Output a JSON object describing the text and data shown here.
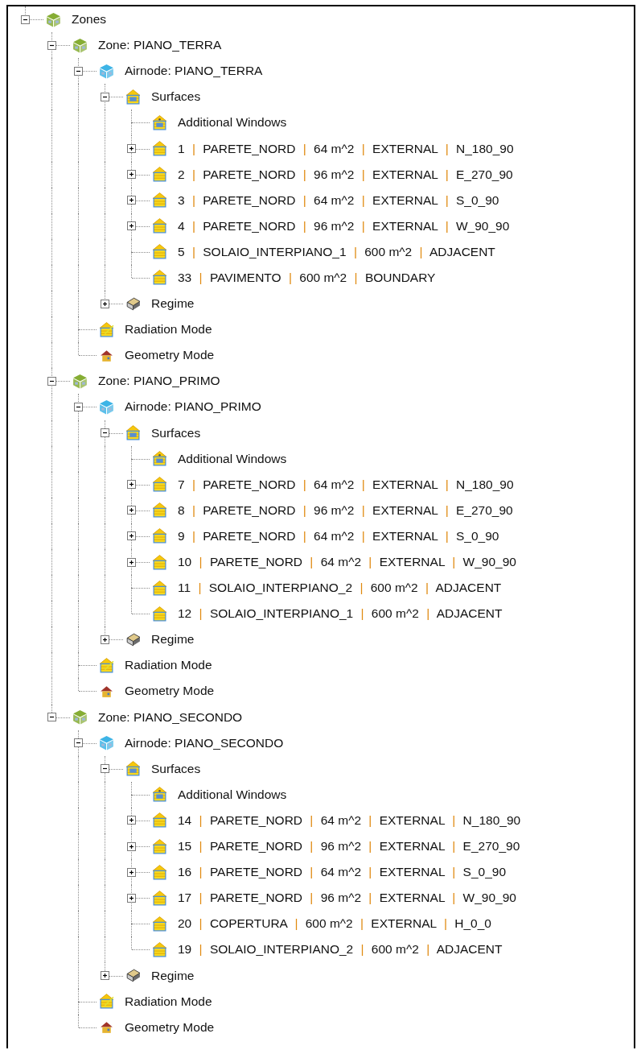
{
  "tree": [
    {
      "kind": "zones",
      "label": "Zones",
      "expanded": true,
      "children": [
        {
          "kind": "zone",
          "label": "Zone: PIANO_TERRA",
          "expanded": true,
          "children": [
            {
              "kind": "airnode",
              "label": "Airnode: PIANO_TERRA",
              "expanded": true,
              "children": [
                {
                  "kind": "surfaces",
                  "label": "Surfaces",
                  "expanded": true,
                  "children": [
                    {
                      "kind": "windows",
                      "label": "Additional Windows"
                    },
                    {
                      "kind": "surface",
                      "label": "1 | PARETE_NORD | 64 m^2 | EXTERNAL | N_180_90",
                      "expanded": false
                    },
                    {
                      "kind": "surface",
                      "label": "2 | PARETE_NORD | 96 m^2 | EXTERNAL | E_270_90",
                      "expanded": false
                    },
                    {
                      "kind": "surface",
                      "label": "3 | PARETE_NORD | 64 m^2 | EXTERNAL | S_0_90",
                      "expanded": false
                    },
                    {
                      "kind": "surface",
                      "label": "4 | PARETE_NORD | 96 m^2 | EXTERNAL | W_90_90",
                      "expanded": false
                    },
                    {
                      "kind": "surface",
                      "label": "5 | SOLAIO_INTERPIANO_1 | 600 m^2 | ADJACENT"
                    },
                    {
                      "kind": "surface",
                      "label": "33 | PAVIMENTO | 600 m^2 | BOUNDARY"
                    }
                  ]
                },
                {
                  "kind": "regime",
                  "label": "Regime",
                  "expanded": false
                }
              ]
            },
            {
              "kind": "radiation",
              "label": "Radiation Mode"
            },
            {
              "kind": "geometry",
              "label": "Geometry Mode"
            }
          ]
        },
        {
          "kind": "zone",
          "label": "Zone: PIANO_PRIMO",
          "expanded": true,
          "children": [
            {
              "kind": "airnode",
              "label": "Airnode: PIANO_PRIMO",
              "expanded": true,
              "children": [
                {
                  "kind": "surfaces",
                  "label": "Surfaces",
                  "expanded": true,
                  "children": [
                    {
                      "kind": "windows",
                      "label": "Additional Windows"
                    },
                    {
                      "kind": "surface",
                      "label": "7 | PARETE_NORD | 64 m^2 | EXTERNAL | N_180_90",
                      "expanded": false
                    },
                    {
                      "kind": "surface",
                      "label": "8 | PARETE_NORD | 96 m^2 | EXTERNAL | E_270_90",
                      "expanded": false
                    },
                    {
                      "kind": "surface",
                      "label": "9 | PARETE_NORD | 64 m^2 | EXTERNAL | S_0_90",
                      "expanded": false
                    },
                    {
                      "kind": "surface",
                      "label": "10 | PARETE_NORD | 64 m^2 | EXTERNAL | W_90_90",
                      "expanded": false
                    },
                    {
                      "kind": "surface",
                      "label": "11 | SOLAIO_INTERPIANO_2 | 600 m^2 | ADJACENT"
                    },
                    {
                      "kind": "surface",
                      "label": "12 | SOLAIO_INTERPIANO_1 | 600 m^2 | ADJACENT"
                    }
                  ]
                },
                {
                  "kind": "regime",
                  "label": "Regime",
                  "expanded": false
                }
              ]
            },
            {
              "kind": "radiation",
              "label": "Radiation Mode"
            },
            {
              "kind": "geometry",
              "label": "Geometry Mode"
            }
          ]
        },
        {
          "kind": "zone",
          "label": "Zone: PIANO_SECONDO",
          "expanded": true,
          "children": [
            {
              "kind": "airnode",
              "label": "Airnode: PIANO_SECONDO",
              "expanded": true,
              "children": [
                {
                  "kind": "surfaces",
                  "label": "Surfaces",
                  "expanded": true,
                  "children": [
                    {
                      "kind": "windows",
                      "label": "Additional Windows"
                    },
                    {
                      "kind": "surface",
                      "label": "14 | PARETE_NORD | 64 m^2 | EXTERNAL | N_180_90",
                      "expanded": false
                    },
                    {
                      "kind": "surface",
                      "label": "15 | PARETE_NORD | 96 m^2 | EXTERNAL | E_270_90",
                      "expanded": false
                    },
                    {
                      "kind": "surface",
                      "label": "16 | PARETE_NORD | 64 m^2 | EXTERNAL | S_0_90",
                      "expanded": false
                    },
                    {
                      "kind": "surface",
                      "label": "17 | PARETE_NORD | 96 m^2 | EXTERNAL | W_90_90",
                      "expanded": false
                    },
                    {
                      "kind": "surface",
                      "label": "20 | COPERTURA | 600 m^2 | EXTERNAL | H_0_0"
                    },
                    {
                      "kind": "surface",
                      "label": "19 | SOLAIO_INTERPIANO_2 | 600 m^2 | ADJACENT"
                    }
                  ]
                },
                {
                  "kind": "regime",
                  "label": "Regime",
                  "expanded": false
                }
              ]
            },
            {
              "kind": "radiation",
              "label": "Radiation Mode"
            },
            {
              "kind": "geometry",
              "label": "Geometry Mode"
            }
          ]
        }
      ]
    }
  ]
}
